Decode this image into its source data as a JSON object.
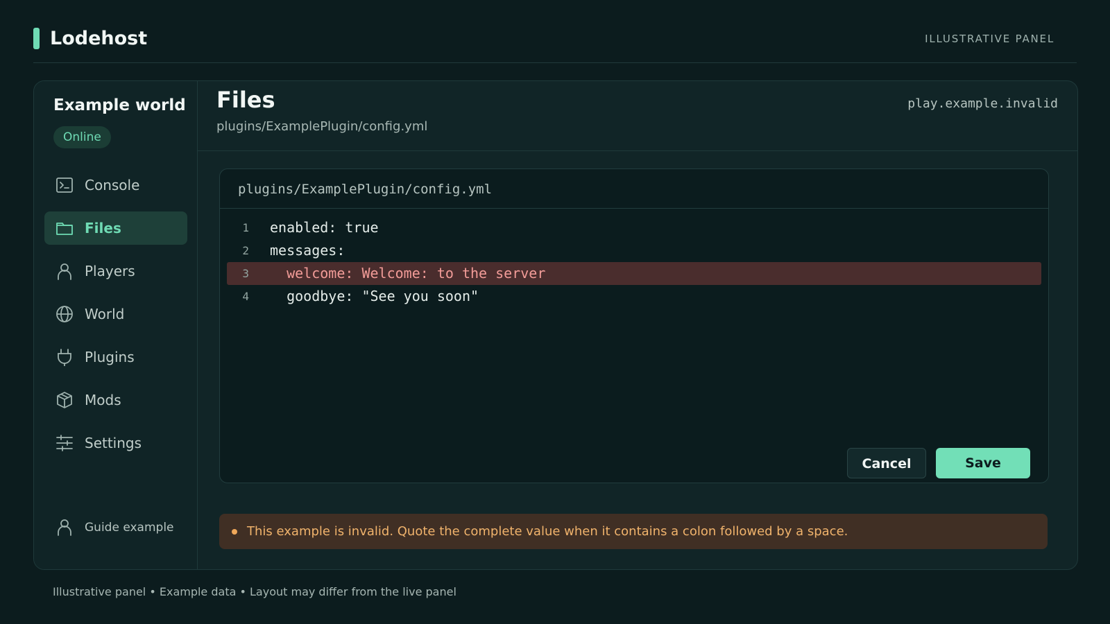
{
  "brand": {
    "name": "Lodehost",
    "tag": "ILLUSTRATIVE PANEL"
  },
  "sidebar": {
    "server_name": "Example world",
    "status": "Online",
    "items": [
      {
        "label": "Console",
        "icon": "terminal-icon",
        "active": false
      },
      {
        "label": "Files",
        "icon": "folder-icon",
        "active": true
      },
      {
        "label": "Players",
        "icon": "person-icon",
        "active": false
      },
      {
        "label": "World",
        "icon": "globe-icon",
        "active": false
      },
      {
        "label": "Plugins",
        "icon": "plug-icon",
        "active": false
      },
      {
        "label": "Mods",
        "icon": "box-icon",
        "active": false
      },
      {
        "label": "Settings",
        "icon": "sliders-icon",
        "active": false
      }
    ],
    "guide": {
      "label": "Guide example",
      "icon": "person-icon"
    }
  },
  "page": {
    "title": "Files",
    "path": "plugins/ExamplePlugin/config.yml",
    "host": "play.example.invalid"
  },
  "editor": {
    "file": "plugins/ExamplePlugin/config.yml",
    "lines": [
      {
        "no": "1",
        "text": "enabled: true",
        "error": false
      },
      {
        "no": "2",
        "text": "messages:",
        "error": false
      },
      {
        "no": "3",
        "text": "  welcome: Welcome: to the server",
        "error": true
      },
      {
        "no": "4",
        "text": "  goodbye: \"See you soon\"",
        "error": false
      }
    ],
    "cancel_label": "Cancel",
    "save_label": "Save"
  },
  "alert": {
    "text": "This example is invalid. Quote the complete value when it contains a colon followed by a space."
  },
  "footer": {
    "text": "Illustrative panel • Example data • Layout may differ from the live panel"
  },
  "colors": {
    "background": "#0c1c1e",
    "accent": "#6fdbb4",
    "error_line": "#4a2d2d",
    "warning_bg": "#402f24",
    "warning_text": "#f0b36c"
  }
}
